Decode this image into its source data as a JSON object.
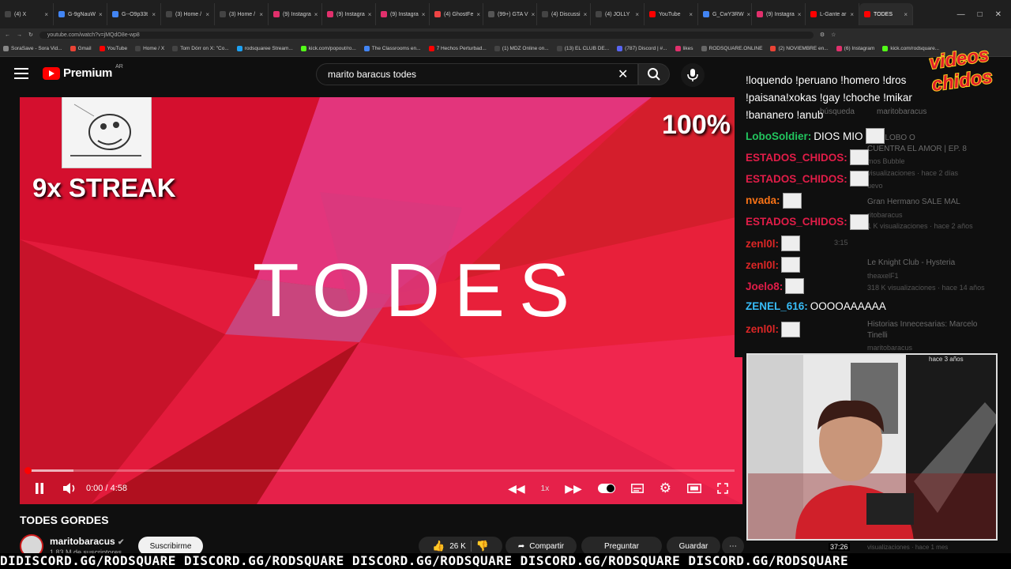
{
  "browser": {
    "tabs": [
      "(4) X",
      "G-9gNauW",
      "G--O9p33t",
      "(3) Home /",
      "(3) Home /",
      "(9) Instagra",
      "(9) Instagra",
      "(9) Instagra",
      "(4) GhostFe",
      "(99+) GTA V",
      "(4) Discussi",
      "(4) JOLLY",
      "YouTube",
      "G_CwY3RW",
      "(9) Instagra",
      "L-Gante ar",
      "TODES"
    ],
    "url": "youtube.com/watch?v=jMQdO8e-wp8",
    "bookmarks": [
      "SoraSave - Sora Vid...",
      "Gmail",
      "YouTube",
      "Home / X",
      "Tom Dórr on X: \"Co...",
      "rodsquaree Stream...",
      "kick.com/popout/ro...",
      "The Classrooms en...",
      "7 Hechos Perturbad...",
      "(1) MDZ Online on...",
      "(13) EL CLUB DE...",
      "(787) Discord | #...",
      "likes",
      "RODSQUARE.ONLINE",
      "(2) NOVIEMBRE en...",
      "(6) Instagram",
      "kick.com/rodsquare..."
    ]
  },
  "youtube": {
    "logo_text": "Premium",
    "region": "AR",
    "search_value": "marito baracus todes"
  },
  "player": {
    "overlay_streak": "9x STREAK",
    "overlay_percent": "100%",
    "title_card": "TODES",
    "time": "0:00 / 4:58",
    "progress_fraction": 0.0,
    "buffer_fraction": 0.065,
    "speed": "1x"
  },
  "video_info": {
    "title": "TODES GORDES",
    "channel": "maritobaracus",
    "subscribers": "1,83 M de suscriptores",
    "subscribe_label": "Suscribirme",
    "likes": "26 K",
    "share_label": "Compartir",
    "ask_label": "Preguntar",
    "save_label": "Guardar"
  },
  "chat": {
    "commands_1": "!loquendo !peruano !homero !dros",
    "commands_2": "!paisana!xokas !gay !choche !mikar",
    "commands_3": "!bananero !anub",
    "messages": [
      {
        "name": "LoboSoldier",
        "text": "DIOS MIO",
        "color": "#22c55e"
      },
      {
        "name": "ESTADOS_CHIDOS",
        "text": "",
        "color": "#e11d48"
      },
      {
        "name": "ESTADOS_CHIDOS",
        "text": "",
        "color": "#e11d48"
      },
      {
        "name": "nvada",
        "text": "",
        "color": "#f97316"
      },
      {
        "name": "ESTADOS_CHIDOS",
        "text": "",
        "color": "#e11d48"
      },
      {
        "name": "zenl0l",
        "text": "",
        "color": "#dc2626"
      },
      {
        "name": "zenl0l",
        "text": "",
        "color": "#dc2626"
      },
      {
        "name": "Joelo8",
        "text": "",
        "color": "#e11d48"
      },
      {
        "name": "ZENEL_616",
        "text": "OOOOAAAAAA",
        "color": "#38bdf8"
      },
      {
        "name": "zenl0l",
        "text": "",
        "color": "#dc2626"
      }
    ]
  },
  "recommended": {
    "chip_1": "búsqueda",
    "chip_2": "maritobaracus",
    "r1_title": "EL GLOBO O",
    "r1_line2": "CUENTRA EL AMOR | EP. 8",
    "r1_channel": "mos Bubble",
    "r1_meta": "visualizaciones · hace 2 días",
    "r1_tag": "uevo",
    "r2_title": "Gran Hermano SALE MAL",
    "r2_channel": "ritobaracus",
    "r2_meta": "1 K visualizaciones · hace 2 años",
    "r2_duration": "3:15",
    "r3_title": "Le Knight Club - Hysteria",
    "r3_channel": "theaxelF1",
    "r3_meta": "318 K visualizaciones · hace 14 años",
    "r4_title": "Historias Innecesarias: Marcelo",
    "r4_line2": "Tinelli",
    "r4_channel": "maritobaracus",
    "r5_meta": "hace 3 años",
    "r6_duration": "37:26",
    "r6_meta": "visualizaciones · hace 1 mes"
  },
  "watermark": {
    "line1": "videos",
    "line2": "chidos"
  },
  "ticker": "DIDISCORD.GG/RODSQUARE DISCORD.GG/RODSQUARE DISCORD.GG/RODSQUARE DISCORD.GG/RODSQUARE DISCORD.GG/RODSQUARE"
}
